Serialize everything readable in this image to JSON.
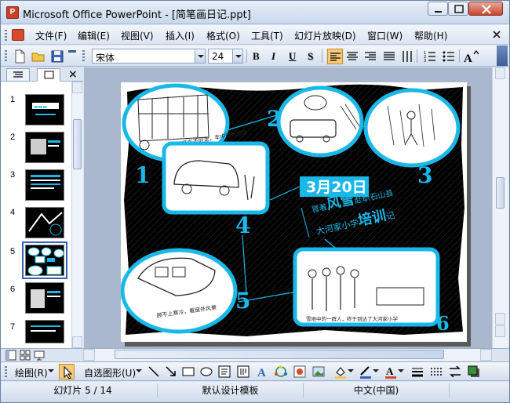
{
  "window": {
    "title": "Microsoft Office PowerPoint - [简笔画日记.ppt]"
  },
  "menu": {
    "items": [
      "文件(F)",
      "编辑(E)",
      "视图(V)",
      "插入(I)",
      "格式(O)",
      "工具(T)",
      "幻灯片放映(D)",
      "窗口(W)",
      "帮助(H)"
    ]
  },
  "toolbar": {
    "font_name": "宋体",
    "font_size": "24",
    "bold": "B",
    "italic": "I",
    "underline": "U",
    "shadow": "S"
  },
  "thumbnails": {
    "numbers": [
      "1",
      "2",
      "3",
      "4",
      "5",
      "6",
      "7"
    ],
    "selected": "5"
  },
  "slide": {
    "numbers": [
      "1",
      "2",
      "3",
      "4",
      "5",
      "6"
    ],
    "date": "3月20日",
    "line1_a": "冒着",
    "line1_b": "风雪",
    "line1_c": "赴职石山县",
    "line2_a": "大河家小学",
    "line2_b": "培训",
    "line2_c": "记",
    "caption1": "因积雪开车不好走，车中时有惊险",
    "caption5": "顾不上寒冷，看窗外风景",
    "caption6": "雪地中的一群人，终于到达了大河家小学",
    "accent": "#1ab8e8"
  },
  "drawbar": {
    "draw_label": "绘图(R)",
    "autoshape_label": "自选图形(U)"
  },
  "status": {
    "slide_info": "幻灯片 5 / 14",
    "template": "默认设计模板",
    "language": "中文(中国)"
  }
}
